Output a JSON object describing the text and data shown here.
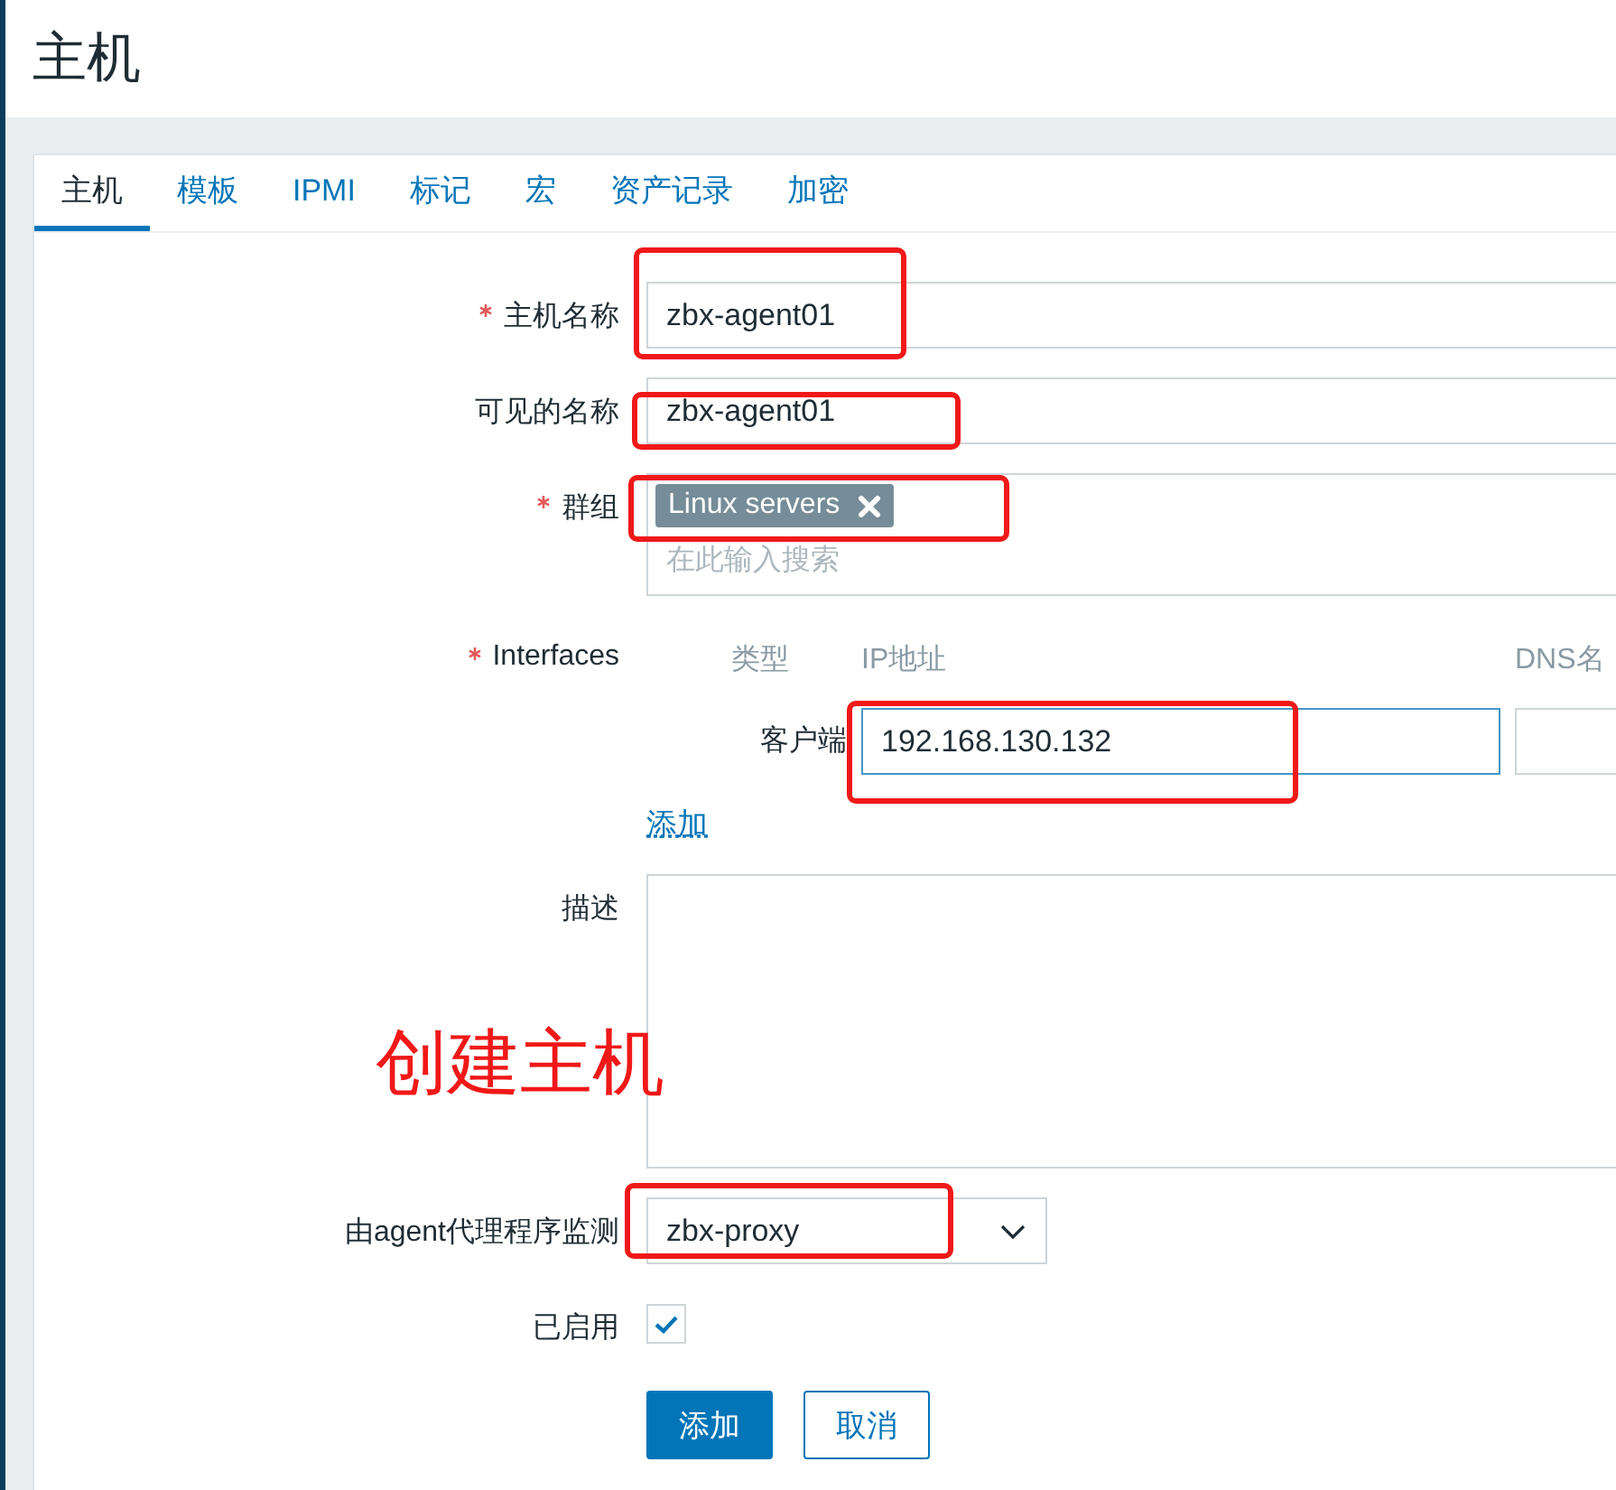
{
  "page_title": "主机",
  "tabs": [
    {
      "label": "主机",
      "selected": true
    },
    {
      "label": "模板",
      "selected": false
    },
    {
      "label": "IPMI",
      "selected": false
    },
    {
      "label": "标记",
      "selected": false
    },
    {
      "label": "宏",
      "selected": false
    },
    {
      "label": "资产记录",
      "selected": false
    },
    {
      "label": "加密",
      "selected": false
    }
  ],
  "fields": [
    {
      "kind": "text",
      "label": "主机名称",
      "required": true,
      "value": "zbx-agent01",
      "highlighted": true
    },
    {
      "kind": "text",
      "label": "可见的名称",
      "required": false,
      "value": "zbx-agent01",
      "highlighted": true
    },
    {
      "kind": "multiselect",
      "label": "群组",
      "required": true,
      "tags": [
        "Linux servers"
      ],
      "placeholder": "在此输入搜索",
      "highlighted": true
    },
    {
      "kind": "interfaces",
      "label": "Interfaces",
      "required": true,
      "columns": [
        "类型",
        "IP地址",
        "DNS名"
      ],
      "rows": [
        {
          "type": "客户端",
          "ip": "192.168.130.132",
          "highlighted": true
        }
      ],
      "add_link": "添加"
    },
    {
      "kind": "textarea",
      "label": "描述",
      "required": false
    },
    {
      "kind": "select",
      "label": "由agent代理程序监测",
      "required": false,
      "value": "zbx-proxy",
      "highlighted": true
    },
    {
      "kind": "checkbox",
      "label": "已启用",
      "required": false,
      "checked": true
    }
  ],
  "buttons": [
    {
      "label": "添加",
      "primary": true
    },
    {
      "label": "取消",
      "primary": false
    }
  ],
  "annotation": "创建主机"
}
